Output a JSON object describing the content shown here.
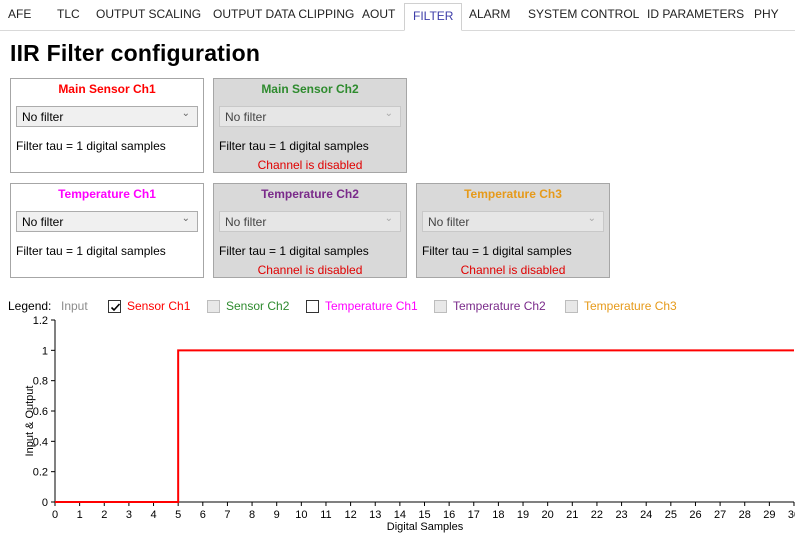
{
  "tabs": [
    {
      "label": "AFE",
      "active": false
    },
    {
      "label": "TLC",
      "active": false
    },
    {
      "label": "OUTPUT SCALING",
      "active": false
    },
    {
      "label": "OUTPUT DATA CLIPPING",
      "active": false
    },
    {
      "label": "AOUT",
      "active": false
    },
    {
      "label": "FILTER",
      "active": true
    },
    {
      "label": "ALARM",
      "active": false
    },
    {
      "label": "SYSTEM CONTROL",
      "active": false
    },
    {
      "label": "ID PARAMETERS",
      "active": false
    },
    {
      "label": "PHY",
      "active": false
    }
  ],
  "page_title": "IIR Filter configuration",
  "cards": [
    {
      "title": "Main Sensor Ch1",
      "title_color": "#ff0000",
      "select_value": "No filter",
      "tau_text": "Filter tau = 1 digital samples",
      "disabled": false,
      "disabled_text": ""
    },
    {
      "title": "Main Sensor Ch2",
      "title_color": "#2e8b2e",
      "select_value": "No filter",
      "tau_text": "Filter tau = 1 digital samples",
      "disabled": true,
      "disabled_text": "Channel is disabled"
    },
    {
      "title": "Temperature Ch1",
      "title_color": "#ff00ff",
      "select_value": "No filter",
      "tau_text": "Filter tau = 1 digital samples",
      "disabled": false,
      "disabled_text": ""
    },
    {
      "title": "Temperature Ch2",
      "title_color": "#7a2a8a",
      "select_value": "No filter",
      "tau_text": "Filter tau = 1 digital samples",
      "disabled": true,
      "disabled_text": "Channel is disabled"
    },
    {
      "title": "Temperature Ch3",
      "title_color": "#e69a1a",
      "select_value": "No filter",
      "tau_text": "Filter tau = 1 digital samples",
      "disabled": true,
      "disabled_text": "Channel is disabled"
    }
  ],
  "legend": {
    "label": "Legend:",
    "input_label": "Input",
    "items": [
      {
        "label": "Sensor Ch1",
        "color": "#ff0000",
        "checked": true,
        "enabled": true
      },
      {
        "label": "Sensor Ch2",
        "color": "#2e8b2e",
        "checked": false,
        "enabled": false
      },
      {
        "label": "Temperature Ch1",
        "color": "#ff00ff",
        "checked": false,
        "enabled": true
      },
      {
        "label": "Temperature Ch2",
        "color": "#7a2a8a",
        "checked": false,
        "enabled": false
      },
      {
        "label": "Temperature Ch3",
        "color": "#e69a1a",
        "checked": false,
        "enabled": false
      }
    ]
  },
  "chart_data": {
    "type": "line",
    "title": "",
    "xlabel": "Digital Samples",
    "ylabel": "Input & Output",
    "xlim": [
      0,
      30
    ],
    "ylim": [
      0,
      1.2
    ],
    "x_ticks": [
      0,
      1,
      2,
      3,
      4,
      5,
      6,
      7,
      8,
      9,
      10,
      11,
      12,
      13,
      14,
      15,
      16,
      17,
      18,
      19,
      20,
      21,
      22,
      23,
      24,
      25,
      26,
      27,
      28,
      29,
      30
    ],
    "x_tick_labels": [
      "0",
      "1",
      "2",
      "3",
      "4",
      "5",
      "6",
      "7",
      "8",
      "9",
      "10",
      "11",
      "12",
      "13",
      "14",
      "15",
      "16",
      "17",
      "18",
      "19",
      "20",
      "21",
      "22",
      "23",
      "24",
      "25",
      "26",
      "27",
      "28",
      "29",
      "30"
    ],
    "y_ticks": [
      0,
      0.2,
      0.4,
      0.6,
      0.8,
      1,
      1.2
    ],
    "y_tick_labels": [
      "0",
      "0.2",
      "0.4",
      "0.6",
      "0.8",
      "1",
      "1.2"
    ],
    "grid": false,
    "series": [
      {
        "name": "Sensor Ch1",
        "color": "#ff0000",
        "x": [
          0,
          5,
          5,
          30
        ],
        "y": [
          0,
          0,
          1,
          1
        ]
      }
    ]
  }
}
